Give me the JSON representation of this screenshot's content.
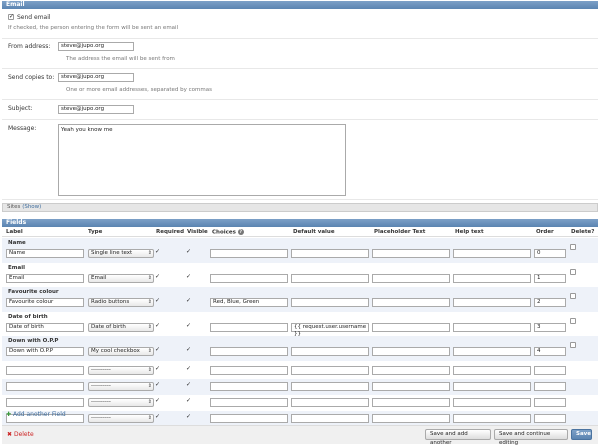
{
  "email_section": {
    "header": "Email",
    "send_email_label": "Send email",
    "send_email_checked": true,
    "send_email_help": "If checked, the person entering the form will be sent an email",
    "from_label": "From address:",
    "from_value": "steve@jupo.org",
    "from_help": "The address the email will be sent from",
    "copies_label": "Send copies to:",
    "copies_value": "steve@jupo.org",
    "copies_help": "One or more email addresses, separated by commas",
    "subject_label": "Subject:",
    "subject_value": "steve@jupo.org",
    "message_label": "Message:",
    "message_value": "Yeah you know me"
  },
  "sites_section": {
    "label": "Sites",
    "toggle": "(Show)"
  },
  "fields_section": {
    "header": "Fields",
    "columns": {
      "label": "Label",
      "type": "Type",
      "required": "Required",
      "visible": "Visible",
      "choices": "Choices",
      "default_value": "Default value",
      "placeholder": "Placeholder Text",
      "help": "Help text",
      "order": "Order",
      "delete": "Delete?"
    },
    "rows": [
      {
        "title": "Name",
        "label": "Name",
        "type": "Single line text",
        "required": true,
        "visible": true,
        "choices": "",
        "default": "",
        "order": "0"
      },
      {
        "title": "Email",
        "label": "Email",
        "type": "Email",
        "required": true,
        "visible": true,
        "choices": "",
        "default": "",
        "order": "1"
      },
      {
        "title": "Favourite colour",
        "label": "Favourite colour",
        "type": "Radio buttons",
        "required": true,
        "visible": true,
        "choices": "Red, Blue, Green",
        "default": "",
        "order": "2"
      },
      {
        "title": "Date of birth",
        "label": "Date of birth",
        "type": "Date of birth",
        "required": true,
        "visible": true,
        "choices": "",
        "default": "{{ request.user.username }}",
        "order": "3"
      },
      {
        "title": "Down with O.P.P",
        "label": "Down with O.P.P",
        "type": "My cool checkbox",
        "required": true,
        "visible": true,
        "choices": "",
        "default": "",
        "order": "4"
      }
    ],
    "empty_rows": [
      {
        "type": "----------",
        "required": true,
        "visible": true
      },
      {
        "type": "----------",
        "required": true,
        "visible": true
      },
      {
        "type": "----------",
        "required": true,
        "visible": true
      },
      {
        "type": "----------",
        "required": true,
        "visible": true
      }
    ],
    "add_another": "Add another Field"
  },
  "footer": {
    "delete": "Delete",
    "save_add": "Save and add another",
    "save_continue": "Save and continue editing",
    "save": "Save"
  },
  "colors": {
    "header": "#5b84b1",
    "group_bg": "#eef2f9",
    "link": "#3c6b9c",
    "delete": "#cc2222"
  }
}
